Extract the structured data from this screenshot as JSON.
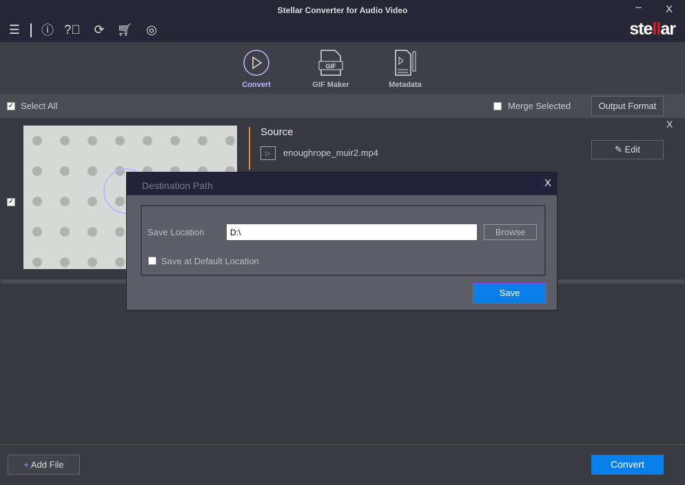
{
  "window": {
    "title": "Stellar Converter for Audio Video",
    "minimize": "–",
    "close": "X"
  },
  "toolbar": {
    "icons": [
      "menu-icon",
      "info-icon",
      "help-icon",
      "refresh-icon",
      "cart-icon",
      "user-icon"
    ],
    "logo_a": "ste",
    "logo_b": "ll",
    "logo_c": "ar"
  },
  "modes": [
    {
      "label": "Convert",
      "active": true
    },
    {
      "label": "GIF Maker",
      "icon_text": "GIF"
    },
    {
      "label": "Metadata"
    }
  ],
  "selection": {
    "select_all": "Select All",
    "merge_selected": "Merge Selected",
    "output_format": "Output Format"
  },
  "item": {
    "source_label": "Source",
    "filename": "enoughrope_muir2.mp4",
    "edit": "Edit",
    "close": "X"
  },
  "dialog": {
    "title": "Destination Path",
    "close": "X",
    "save_location_label": "Save Location",
    "save_location_value": "D:\\",
    "browse": "Browse",
    "default_location": "Save at Default Location",
    "save": "Save"
  },
  "footer": {
    "add_file": "Add File",
    "add_icon": "+",
    "convert": "Convert"
  },
  "colors": {
    "accent": "#0a7ee8",
    "active_mode": "#b9b9ff",
    "source_bar": "#e08a1e"
  }
}
